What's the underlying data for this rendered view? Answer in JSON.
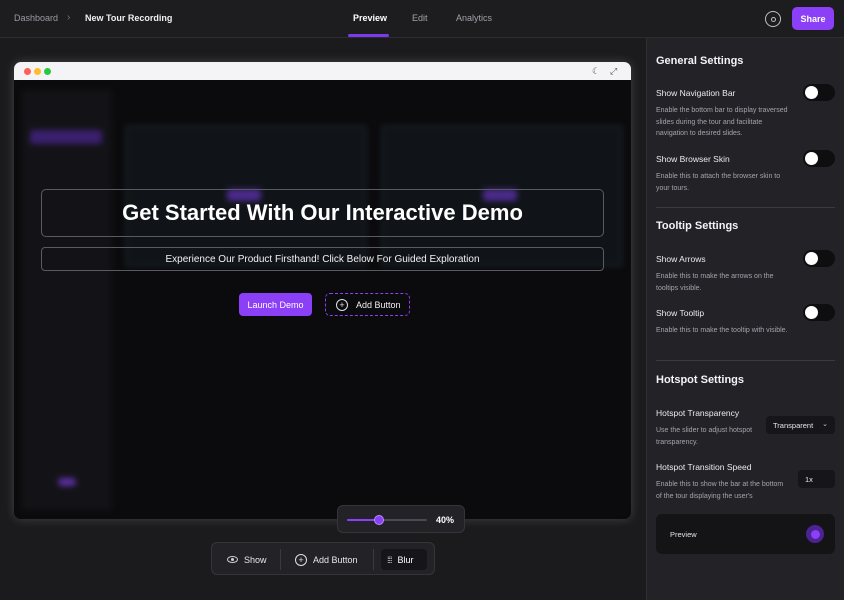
{
  "header": {
    "breadcrumb_root": "Dashboard",
    "breadcrumb_current": "New Tour Recording",
    "tabs": [
      {
        "label": "Preview",
        "active": true
      },
      {
        "label": "Edit",
        "active": false
      },
      {
        "label": "Analytics",
        "active": false
      }
    ],
    "settings_icon": "gear-icon",
    "share_label": "Share"
  },
  "demo": {
    "headline": "Get Started With Our Interactive Demo",
    "subtitle": "Experience Our Product Firsthand! Click Below For Guided Exploration",
    "launch_label": "Launch Demo",
    "add_button_label": "Add Button"
  },
  "blur_slider": {
    "value_label": "40%",
    "value": 0.4
  },
  "toolbar": {
    "show_label": "Show",
    "add_button_label": "Add Button",
    "blur_label": "Blur"
  },
  "settings": {
    "general": {
      "title": "General Settings",
      "nav_bar_title": "Show Navigation Bar",
      "nav_bar_desc": "Enable the bottom bar to display traversed slides during the tour and facilitate navigation to desired slides.",
      "browser_skin_title": "Show Browser Skin",
      "browser_skin_desc": "Enable this to attach the browser skin to your tours."
    },
    "tooltip": {
      "title": "Tooltip Settings",
      "arrows_title": "Show Arrows",
      "arrows_desc": "Enable this to make the arrows on the tooltips visible.",
      "tooltip_title": "Show Tooltip",
      "tooltip_desc": "Enable this to make the tooltip with visible."
    },
    "hotspot": {
      "title": "Hotspot Settings",
      "transparency_title": "Hotspot Transparency",
      "transparency_desc": "Use the slider to adjust hotspot transparency.",
      "transparency_value": "Transparent",
      "speed_title": "Hotspot Transition Speed",
      "speed_desc": "Enable this to show the bar at the bottom of the tour displaying the user's",
      "speed_value": "1x",
      "preview_label": "Preview"
    }
  },
  "colors": {
    "accent": "#8b3ff6",
    "background": "#1b1b1e",
    "panel": "#232327"
  }
}
